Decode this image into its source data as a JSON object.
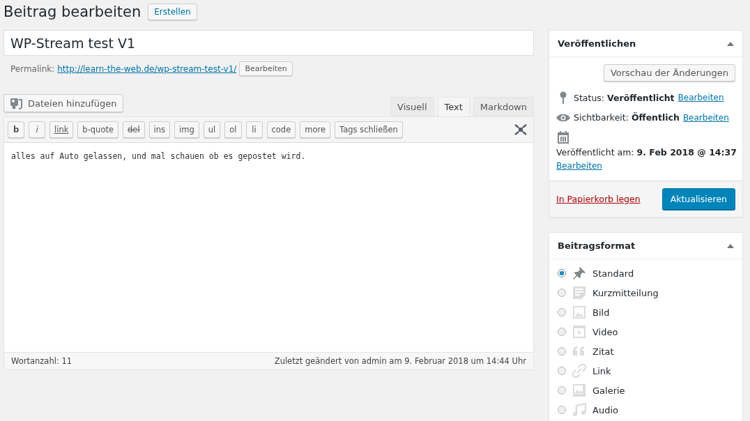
{
  "heading": {
    "title": "Beitrag bearbeiten",
    "add_button": "Erstellen"
  },
  "post_title": {
    "value": "WP-Stream test V1"
  },
  "permalink": {
    "label": "Permalink:",
    "url": "http://learn-the-web.de/wp-stream-test-v1/",
    "edit_button": "Bearbeiten"
  },
  "media_button": "Dateien hinzufügen",
  "editor_tabs": [
    {
      "label": "Visuell",
      "selected": false
    },
    {
      "label": "Text",
      "selected": true
    },
    {
      "label": "Markdown",
      "selected": false
    }
  ],
  "toolbar": [
    {
      "label": "b",
      "kind": "bold"
    },
    {
      "label": "i",
      "kind": "italic"
    },
    {
      "label": "link",
      "kind": "underline"
    },
    {
      "label": "b-quote",
      "kind": "plain"
    },
    {
      "label": "del",
      "kind": "strike"
    },
    {
      "label": "ins",
      "kind": "plain"
    },
    {
      "label": "img",
      "kind": "plain"
    },
    {
      "label": "ul",
      "kind": "plain"
    },
    {
      "label": "ol",
      "kind": "plain"
    },
    {
      "label": "li",
      "kind": "plain"
    },
    {
      "label": "code",
      "kind": "plain"
    },
    {
      "label": "more",
      "kind": "plain"
    },
    {
      "label": "Tags schließen",
      "kind": "plain"
    }
  ],
  "content": "alles auf Auto gelassen, und mal schauen ob es gepostet wird.",
  "status_bar": {
    "word_count": "Wortanzahl: 11",
    "last_edited": "Zuletzt geändert von admin am 9. Februar 2018 um 14:44 Uhr"
  },
  "publish_box": {
    "title": "Veröffentlichen",
    "preview_button": "Vorschau der Änderungen",
    "rows": [
      {
        "kind": "status",
        "label": "Status:",
        "value": "Veröffentlicht",
        "link": "Bearbeiten"
      },
      {
        "kind": "visibility",
        "label": "Sichtbarkeit:",
        "value": "Öffentlich",
        "link": "Bearbeiten"
      },
      {
        "kind": "date",
        "label": "Veröffentlicht am:",
        "value": "9. Feb 2018 @ 14:37",
        "link": "Bearbeiten"
      }
    ],
    "trash_link": "In Papierkorb legen",
    "update_button": "Aktualisieren"
  },
  "format_box": {
    "title": "Beitragsformat",
    "options": [
      {
        "label": "Standard",
        "kind": "pin",
        "selected": true
      },
      {
        "label": "Kurzmitteilung",
        "kind": "note",
        "selected": false
      },
      {
        "label": "Bild",
        "kind": "image",
        "selected": false
      },
      {
        "label": "Video",
        "kind": "video",
        "selected": false
      },
      {
        "label": "Zitat",
        "kind": "quote",
        "selected": false
      },
      {
        "label": "Link",
        "kind": "link",
        "selected": false
      },
      {
        "label": "Galerie",
        "kind": "gallery",
        "selected": false
      },
      {
        "label": "Audio",
        "kind": "audio",
        "selected": false
      }
    ]
  }
}
